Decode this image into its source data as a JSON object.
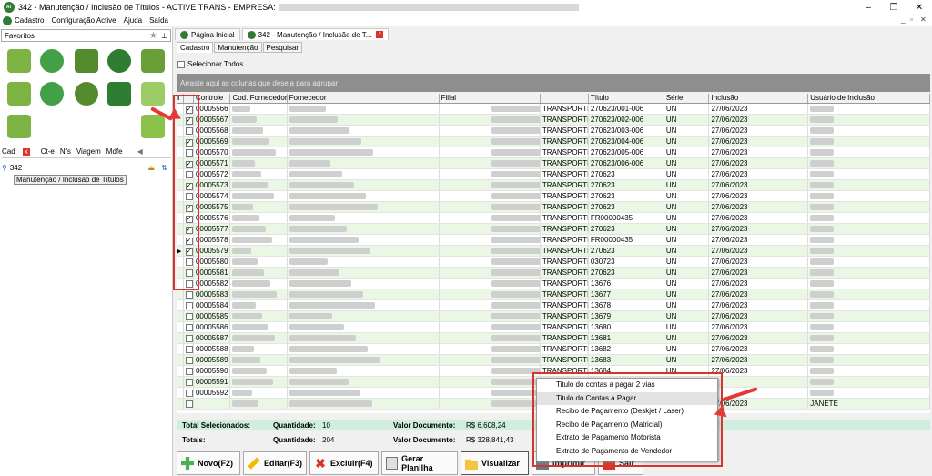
{
  "window": {
    "title": "342 - Manutenção / Inclusão de Títulos - ACTIVE TRANS - EMPRESA:"
  },
  "menu": [
    "Cadastro",
    "Configuração Active",
    "Ajuda",
    "Saída"
  ],
  "left": {
    "favorites_label": "Favoritos",
    "tabs": [
      "Cad",
      "Ct-e",
      "Nfs",
      "Viagem",
      "Mdfe"
    ],
    "search_value": "342",
    "tree_item": "Manutenção / Inclusão de Títulos"
  },
  "doc_tabs": [
    "Página Inicial",
    "342 - Manutenção / Inclusão de T..."
  ],
  "sub_tabs": [
    "Cadastro",
    "Manutenção",
    "Pesquisar"
  ],
  "select_all_label": "Selecionar Todos",
  "group_hint": "Arraste aqui as colunas que deseja para agrupar",
  "grid": {
    "columns": [
      "Controle",
      "Cod. Fornecedor",
      "Fornecedor",
      "Filial",
      "",
      "Título",
      "Série",
      "Inclusão",
      "Usuário de Inclusão"
    ],
    "rows": [
      {
        "checked": true,
        "controle": "00005566",
        "filial": "TRANSPORTE E LO",
        "titulo": "270623/001-006",
        "serie": "UN",
        "inclusao": "27/06/2023"
      },
      {
        "checked": true,
        "controle": "00005567",
        "filial": "TRANSPORTE E LO",
        "titulo": "270623/002-006",
        "serie": "UN",
        "inclusao": "27/06/2023"
      },
      {
        "checked": false,
        "controle": "00005568",
        "filial": "TRANSPORTE E LO",
        "titulo": "270623/003-006",
        "serie": "UN",
        "inclusao": "27/06/2023"
      },
      {
        "checked": true,
        "controle": "00005569",
        "filial": "TRANSPORTE E LO",
        "titulo": "270623/004-006",
        "serie": "UN",
        "inclusao": "27/06/2023"
      },
      {
        "checked": false,
        "controle": "00005570",
        "filial": "TRANSPORTE E LO",
        "titulo": "270623/005-006",
        "serie": "UN",
        "inclusao": "27/06/2023"
      },
      {
        "checked": true,
        "controle": "00005571",
        "filial": "TRANSPORTE E LO",
        "titulo": "270623/006-006",
        "serie": "UN",
        "inclusao": "27/06/2023"
      },
      {
        "checked": false,
        "controle": "00005572",
        "filial": "TRANSPORTE E LO",
        "titulo": "270623",
        "serie": "UN",
        "inclusao": "27/06/2023"
      },
      {
        "checked": true,
        "controle": "00005573",
        "filial": "TRANSPORTE E LO",
        "titulo": "270623",
        "serie": "UN",
        "inclusao": "27/06/2023"
      },
      {
        "checked": false,
        "controle": "00005574",
        "filial": "TRANSPORTE E LO",
        "titulo": "270623",
        "serie": "UN",
        "inclusao": "27/06/2023"
      },
      {
        "checked": true,
        "controle": "00005575",
        "filial": "TRANSPORTE E LO",
        "titulo": "270623",
        "serie": "UN",
        "inclusao": "27/06/2023"
      },
      {
        "checked": true,
        "controle": "00005576",
        "filial": "TRANSPORTE E LO",
        "titulo": "FR00000435",
        "serie": "UN",
        "inclusao": "27/06/2023"
      },
      {
        "checked": true,
        "controle": "00005577",
        "filial": "TRANSPORTE E LO",
        "titulo": "270623",
        "serie": "UN",
        "inclusao": "27/06/2023"
      },
      {
        "checked": true,
        "controle": "00005578",
        "filial": "TRANSPORTE E LO",
        "titulo": "FR00000435",
        "serie": "UN",
        "inclusao": "27/06/2023"
      },
      {
        "checked": true,
        "controle": "00005579",
        "filial": "TRANSPORTE E LO",
        "titulo": "270623",
        "serie": "UN",
        "inclusao": "27/06/2023",
        "current": true
      },
      {
        "checked": false,
        "controle": "00005580",
        "filial": "TRANSPORTE E LO",
        "titulo": "030723",
        "serie": "UN",
        "inclusao": "27/06/2023"
      },
      {
        "checked": false,
        "controle": "00005581",
        "filial": "TRANSPORTE E LO",
        "titulo": "270623",
        "serie": "UN",
        "inclusao": "27/06/2023"
      },
      {
        "checked": false,
        "controle": "00005582",
        "filial": "TRANSPORTE E LO",
        "titulo": "13676",
        "serie": "UN",
        "inclusao": "27/06/2023"
      },
      {
        "checked": false,
        "controle": "00005583",
        "filial": "TRANSPORTE E LO",
        "titulo": "13677",
        "serie": "UN",
        "inclusao": "27/06/2023"
      },
      {
        "checked": false,
        "controle": "00005584",
        "filial": "TRANSPORTE E LO",
        "titulo": "13678",
        "serie": "UN",
        "inclusao": "27/06/2023"
      },
      {
        "checked": false,
        "controle": "00005585",
        "filial": "TRANSPORTE E LO",
        "titulo": "13679",
        "serie": "UN",
        "inclusao": "27/06/2023"
      },
      {
        "checked": false,
        "controle": "00005586",
        "filial": "TRANSPORTE E LO",
        "titulo": "13680",
        "serie": "UN",
        "inclusao": "27/06/2023"
      },
      {
        "checked": false,
        "controle": "00005587",
        "filial": "TRANSPORTE E LO",
        "titulo": "13681",
        "serie": "UN",
        "inclusao": "27/06/2023"
      },
      {
        "checked": false,
        "controle": "00005588",
        "filial": "TRANSPORTE E LO",
        "titulo": "13682",
        "serie": "UN",
        "inclusao": "27/06/2023"
      },
      {
        "checked": false,
        "controle": "00005589",
        "filial": "TRANSPORTE E LO",
        "titulo": "13683",
        "serie": "UN",
        "inclusao": "27/06/2023"
      },
      {
        "checked": false,
        "controle": "00005590",
        "filial": "TRANSPORTE E LO",
        "titulo": "13684",
        "serie": "UN",
        "inclusao": "27/06/2023"
      },
      {
        "checked": false,
        "controle": "00005591",
        "filial": "",
        "titulo": "",
        "serie": "",
        "inclusao": ""
      },
      {
        "checked": false,
        "controle": "00005592",
        "filial": "",
        "titulo": "",
        "serie": "",
        "inclusao": ""
      },
      {
        "checked": false,
        "controle": "",
        "filial": "",
        "titulo": "",
        "serie": "",
        "inclusao": "27/06/2023",
        "usuario": "JANETE"
      }
    ]
  },
  "summary": {
    "selected_label": "Total Selecionados:",
    "qty_label": "Quantidade:",
    "selected_qty": "10",
    "value_label": "Valor Documento:",
    "selected_value": "R$ 6.608,24",
    "totals_label": "Totais:",
    "total_qty": "204",
    "total_value": "R$ 328.841,43"
  },
  "toolbar": {
    "novo": "Novo(F2)",
    "editar": "Editar(F3)",
    "excluir": "Excluir(F4)",
    "planilha": "Gerar Planilha",
    "visualizar": "Visualizar",
    "imprimir": "Imprimir",
    "sair": "Sair"
  },
  "print_menu": [
    "Titulo do contas a pagar 2 vias",
    "Titulo do Contas a Pagar",
    "Recibo de Pagamento (Deskjet / Laser)",
    "Recibo de Pagamento (Matricial)",
    "Extrato de Pagamento Motorista",
    "Extrato de Pagamento de Vendedor"
  ],
  "colors": {
    "accent_red": "#d9342b",
    "row_alt": "#e9f7e4",
    "summary_bg": "#cfeede",
    "group_bar": "#8e8e8e"
  }
}
